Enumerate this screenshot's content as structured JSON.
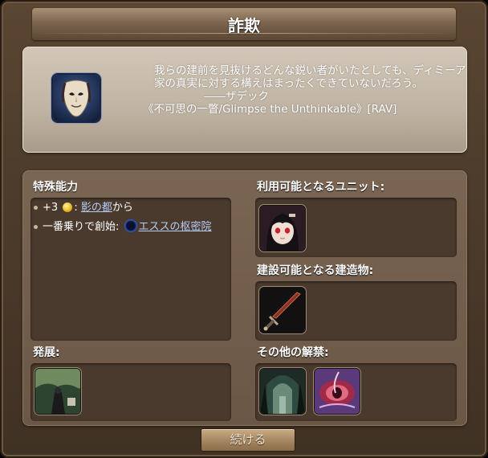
{
  "window": {
    "title": "詐欺"
  },
  "flavor": {
    "icon": "mask-icon",
    "line1": "我らの建前を見抜けるどんな鋭い者がいたとしても、ディミーア",
    "line2": "家の真実に対する構えはまったくできていないだろう。",
    "line3": "――ザデック",
    "line4": "《不可思の一瞥/Glimpse the Unthinkable》[RAV]"
  },
  "abilities": {
    "label": "特殊能力",
    "items": [
      {
        "prefix": "+3",
        "icon": "coin-icon",
        "sep": ":",
        "link": "影の都",
        "suffix": "から"
      },
      {
        "prefix": "一番乗りで創始:",
        "icon": "city-badge-icon",
        "link": "エススの枢密院"
      }
    ]
  },
  "units": {
    "label": "利用可能となるユニット:",
    "items": [
      {
        "icon": "red-eyed-girl-portrait"
      }
    ]
  },
  "buildings": {
    "label": "建設可能となる建造物:",
    "items": [
      {
        "icon": "dagger-icon"
      }
    ]
  },
  "development": {
    "label": "発展:",
    "items": [
      {
        "icon": "cloaked-figure-scene"
      }
    ]
  },
  "other": {
    "label": "その他の解禁:",
    "items": [
      {
        "icon": "forest-archway-scene"
      },
      {
        "icon": "crimson-eye-icon"
      }
    ]
  },
  "footer": {
    "continue_label": "続ける"
  },
  "colors": {
    "frame": "#4d3c2b",
    "panel_light": "#c4b8a8",
    "box_dark": "#4a3a2d",
    "link": "#b6cdf4"
  }
}
